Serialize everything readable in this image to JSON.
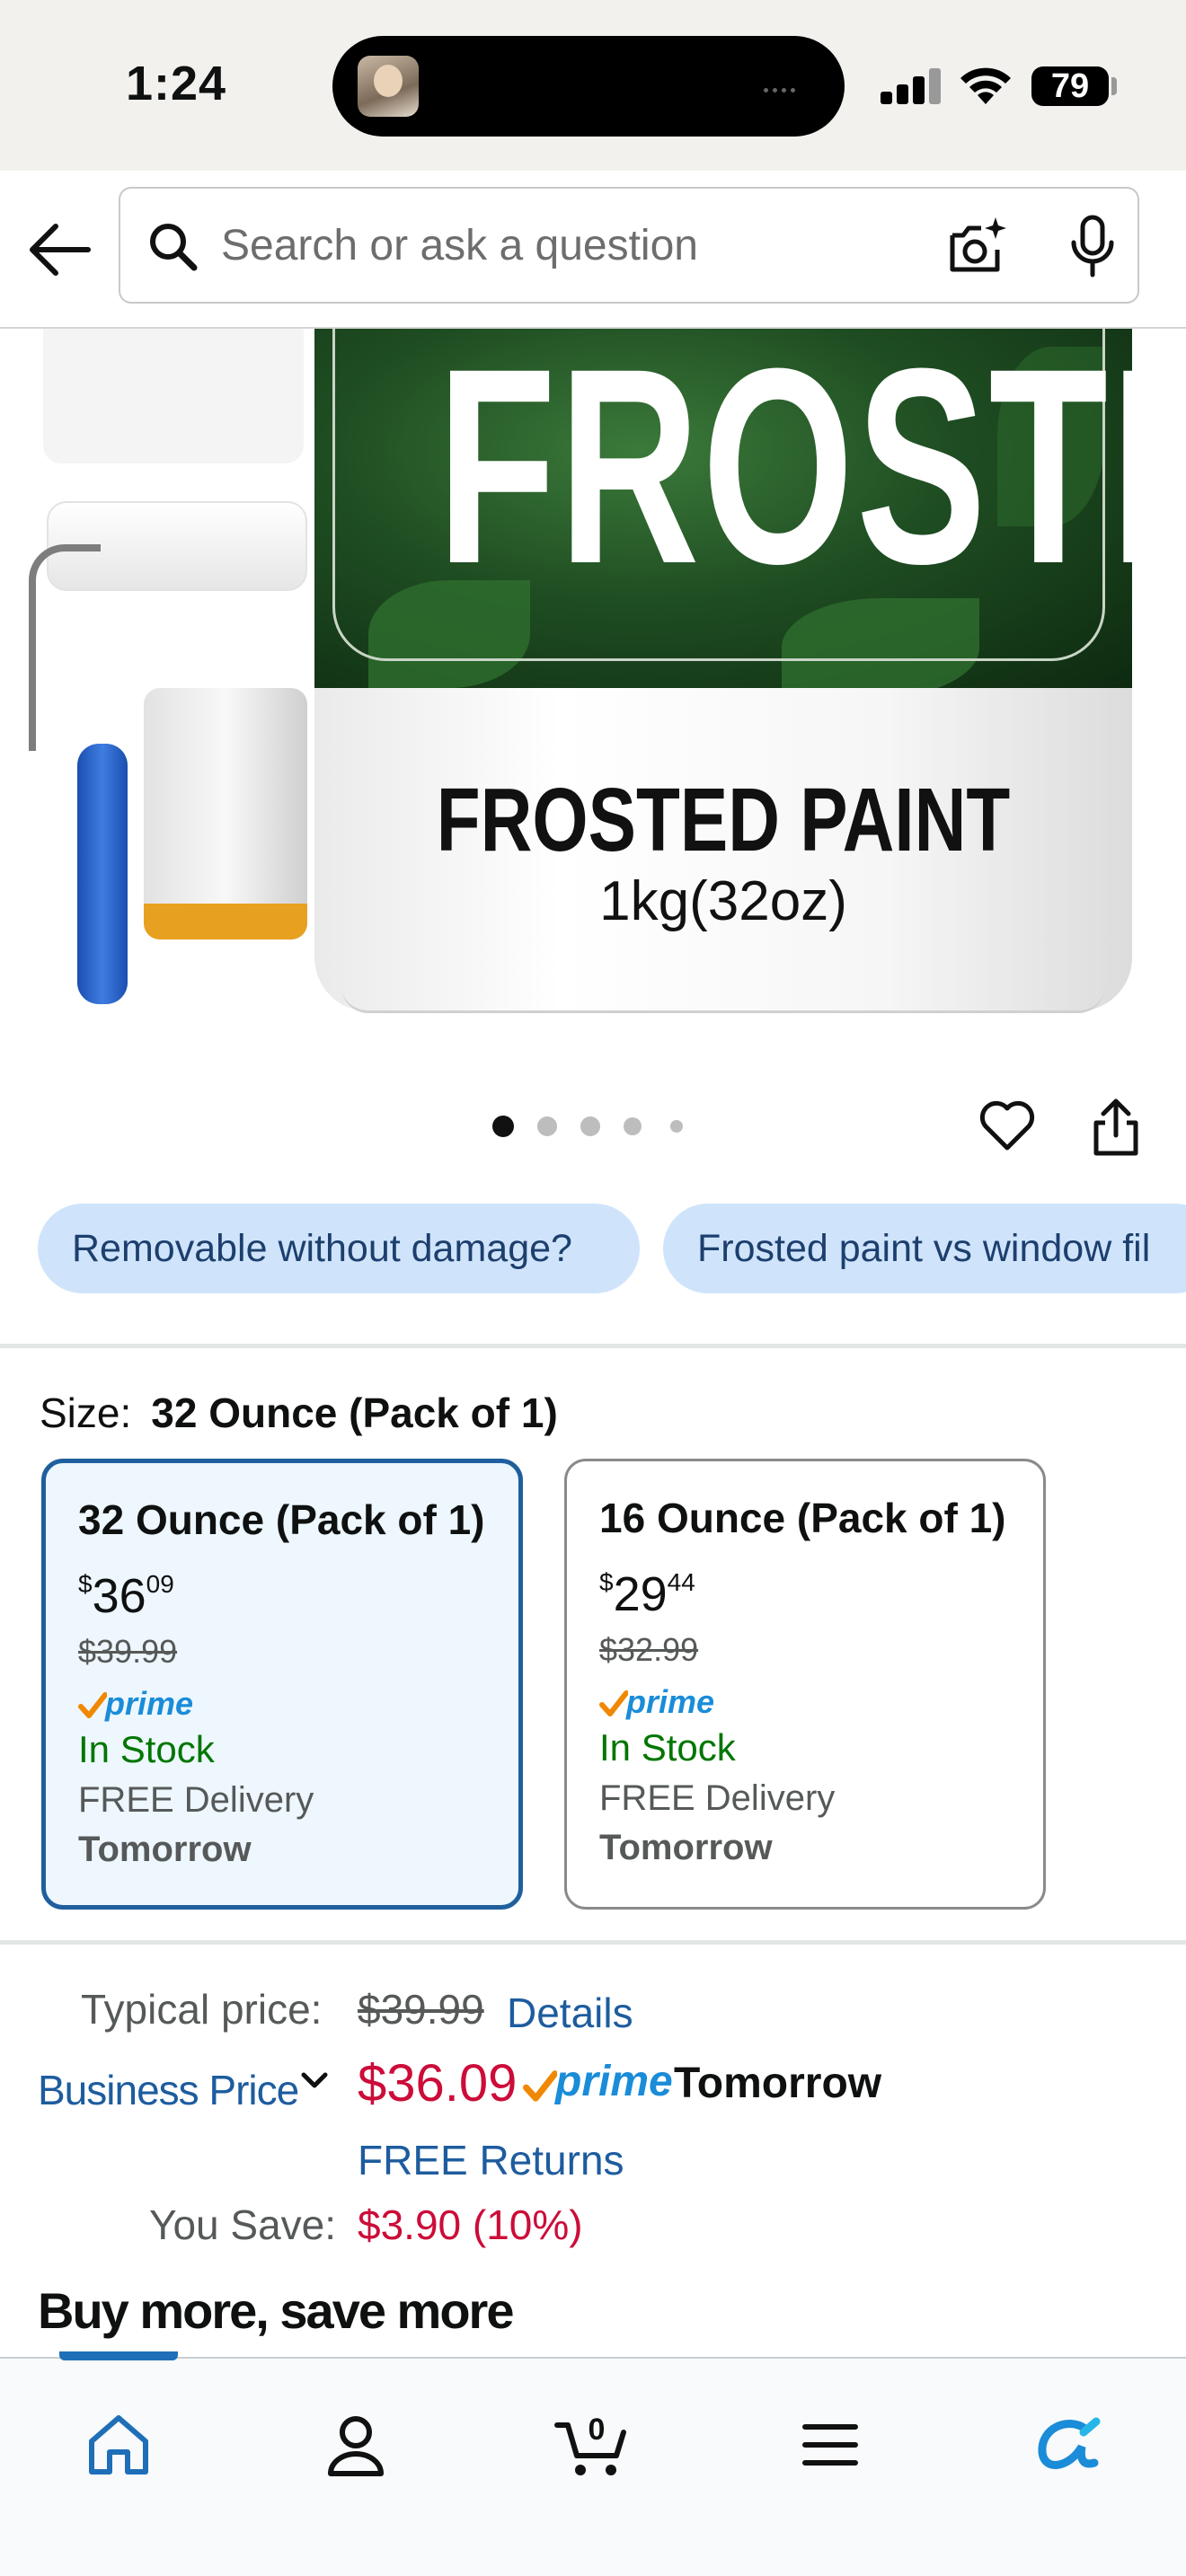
{
  "status_bar": {
    "time": "1:24",
    "battery": "79"
  },
  "search": {
    "placeholder": "Search or ask a question"
  },
  "product_image": {
    "label_brand": "FROSTED",
    "label_name": "FROSTED PAINT",
    "label_weight": "1kg(32oz)",
    "carousel_count": 5,
    "carousel_active": 0
  },
  "chips": [
    "Removable without damage?",
    "Frosted paint vs window fil"
  ],
  "size": {
    "label": "Size:",
    "selected": "32 Ounce (Pack of 1)",
    "options": [
      {
        "title": "32 Ounce (Pack of 1)",
        "price_dollars": "36",
        "price_cents": "09",
        "old_price": "$39.99",
        "prime": "prime",
        "stock": "In Stock",
        "delivery": "FREE Delivery",
        "when": "Tomorrow"
      },
      {
        "title": "16 Ounce (Pack of 1)",
        "price_dollars": "29",
        "price_cents": "44",
        "old_price": "$32.99",
        "prime": "prime",
        "stock": "In Stock",
        "delivery": "FREE Delivery",
        "when": "Tomorrow"
      }
    ]
  },
  "pricing": {
    "typical_label": "Typical price:",
    "typical_value": "$39.99",
    "details_link": "Details",
    "business_link": "Business Price",
    "price": "$36.09",
    "prime": "prime",
    "delivery_when": "Tomorrow",
    "free_returns": "FREE Returns",
    "save_label": "You Save:",
    "save_value": "$3.90 (10%)"
  },
  "buy_more": "Buy more, save more",
  "bottom_nav": {
    "cart_count": "0",
    "items": [
      "home-icon",
      "account-icon",
      "cart-icon",
      "menu-icon",
      "rufus-icon"
    ]
  },
  "colors": {
    "link": "#1d5c9e",
    "price_red": "#cc0c39",
    "stock_green": "#007600",
    "prime_blue": "#1a8cd8",
    "chip_bg": "#cfe4fb",
    "selected_border": "#1f5f9e"
  }
}
